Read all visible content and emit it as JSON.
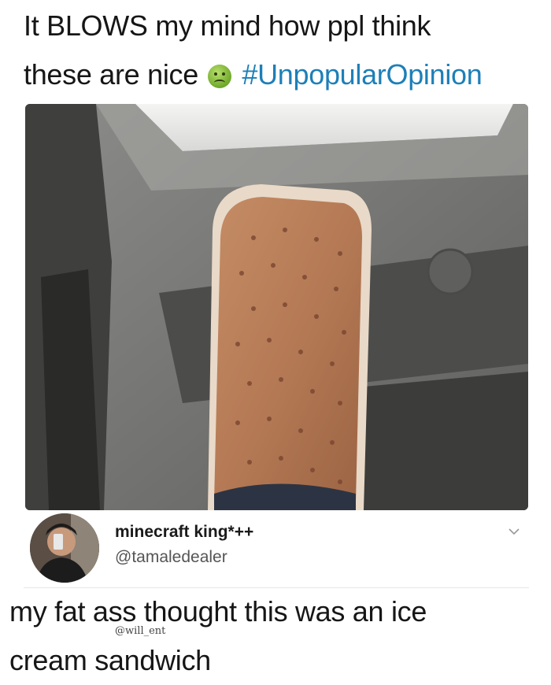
{
  "caption": {
    "line1": "It BLOWS my mind how ppl think",
    "line2_text": "these are nice",
    "emoji": "nauseated-face-icon",
    "hashtag": "#UnpopularOpinion"
  },
  "tweet": {
    "display_name": "minecraft king*++",
    "handle": "@tamaledealer",
    "text_line1": "my fat ass thought this was an ice",
    "text_line2": "cream sandwich"
  },
  "watermark": "@will_ent",
  "colors": {
    "hashtag": "#1d7fb8",
    "boot": "#b57a55",
    "car_interior": "#6d6d6b"
  }
}
